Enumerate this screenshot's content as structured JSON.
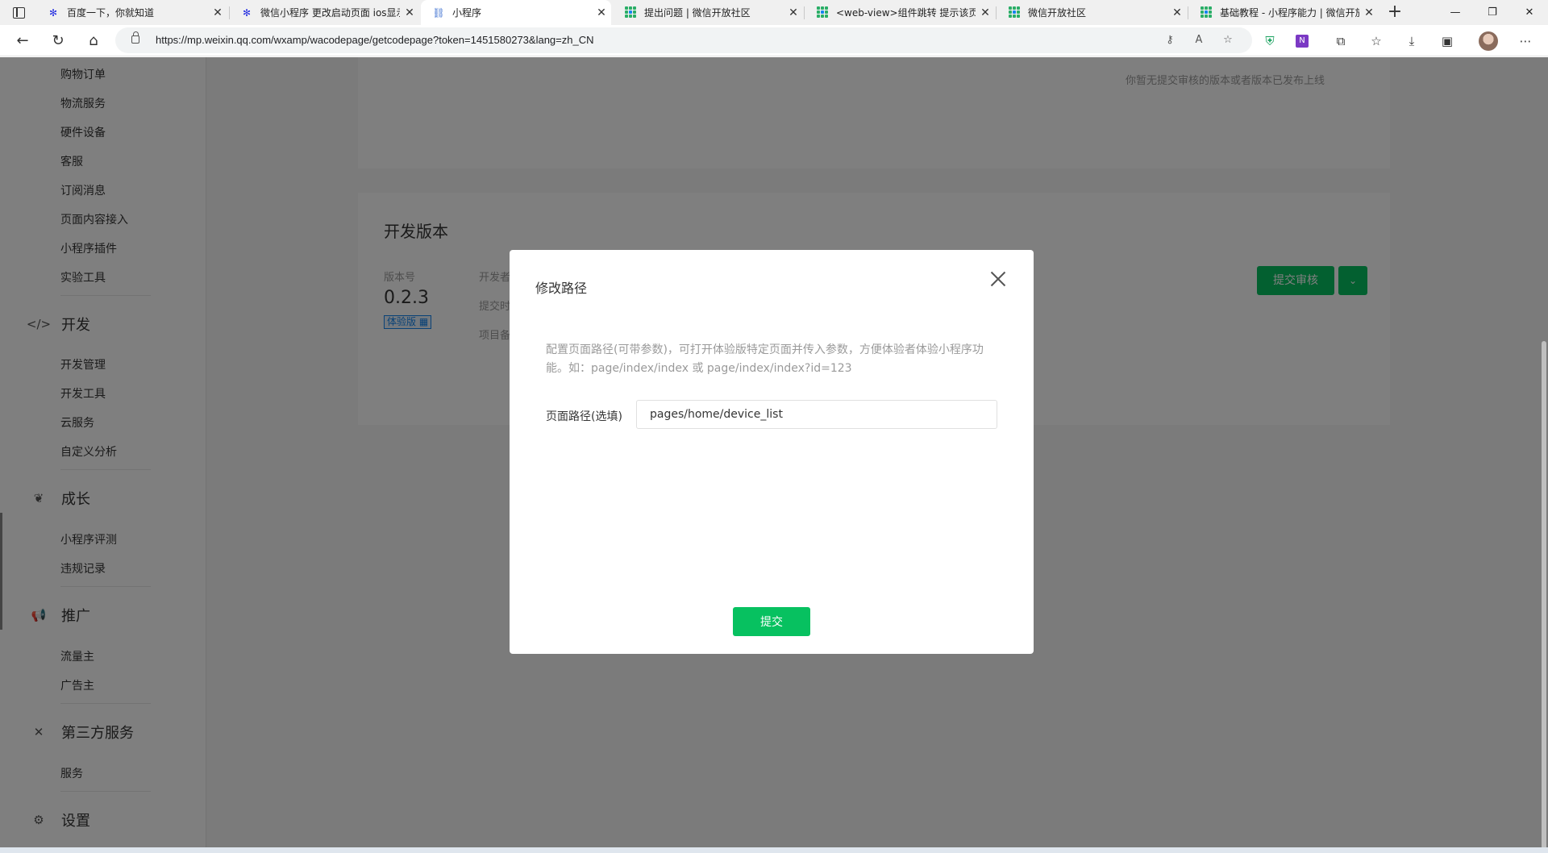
{
  "browser": {
    "tabs": [
      {
        "title": "百度一下，你就知道",
        "icon": "baidu-paw-icon"
      },
      {
        "title": "微信小程序 更改启动页面 ios显示",
        "icon": "baidu-paw-icon"
      },
      {
        "title": "小程序",
        "icon": "link-icon"
      },
      {
        "title": "提出问题 | 微信开放社区",
        "icon": "wechat-community-icon"
      },
      {
        "title": "<web-view>组件跳转 提示该页面",
        "icon": "wechat-community-icon"
      },
      {
        "title": "微信开放社区",
        "icon": "wechat-community-icon"
      },
      {
        "title": "基础教程 - 小程序能力 | 微信开放",
        "icon": "wechat-community-icon"
      }
    ],
    "active_tab_index": 2,
    "new_tab": "+",
    "window_controls": {
      "minimize": "—",
      "restore": "❐",
      "close": "✕"
    },
    "url": "https://mp.weixin.qq.com/wxamp/wacodepage/getcodepage?token=1451580273&lang=zh_CN"
  },
  "sidebar": {
    "sub_items_top": [
      "购物订单",
      "物流服务",
      "硬件设备",
      "客服",
      "订阅消息",
      "页面内容接入",
      "小程序插件",
      "实验工具"
    ],
    "groups": [
      {
        "label": "开发",
        "icon": "code-icon",
        "items": [
          "开发管理",
          "开发工具",
          "云服务",
          "自定义分析"
        ]
      },
      {
        "label": "成长",
        "icon": "sprout-icon",
        "items": [
          "小程序评测",
          "违规记录"
        ]
      },
      {
        "label": "推广",
        "icon": "megaphone-icon",
        "items": [
          "流量主",
          "广告主"
        ]
      },
      {
        "label": "第三方服务",
        "icon": "third-party-icon",
        "items": [
          "服务"
        ]
      },
      {
        "label": "设置",
        "icon": "gear-icon",
        "items": []
      }
    ]
  },
  "main": {
    "review_notice": "你暂无提交审核的版本或者版本已发布上线",
    "dev_version": {
      "section_title": "开发版本",
      "version_label": "版本号",
      "version": "0.2.3",
      "tag": "体验版",
      "meta_labels": [
        "开发者",
        "提交时",
        "项目备"
      ],
      "submit_review_label": "提交审核"
    }
  },
  "dialog": {
    "title": "修改路径",
    "description": "配置页面路径(可带参数)，可打开体验版特定页面并传入参数，方便体验者体验小程序功能。如：page/index/index 或 page/index/index?id=123",
    "field_label": "页面路径(选填)",
    "field_value": "pages/home/device_list",
    "submit_label": "提交"
  }
}
